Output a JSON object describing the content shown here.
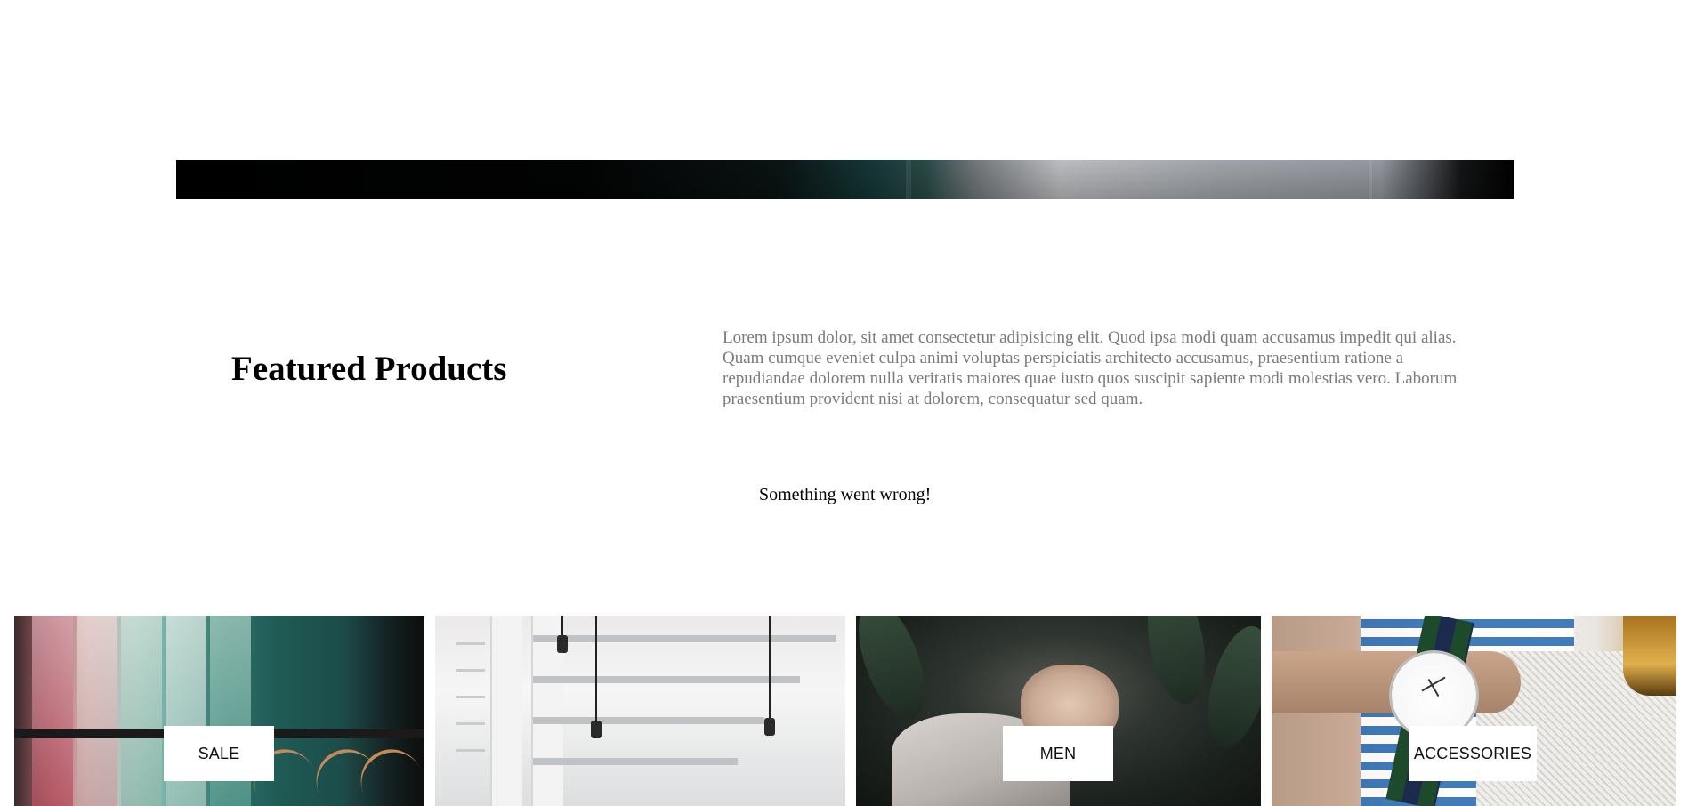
{
  "featured": {
    "title": "Featured Products",
    "description": "Lorem ipsum dolor, sit amet consectetur adipisicing elit. Quod ipsa modi quam accusamus impedit qui alias. Quam cumque eveniet culpa animi voluptas perspiciatis architecto accusamus, praesentium ratione a repudiandae dolorem nulla veritatis maiores quae iusto quos suscipit sapiente modi molestias vero. Laborum praesentium provident nisi at dolorem, consequatur sed quam."
  },
  "status": {
    "error_message": "Something went wrong!"
  },
  "categories": [
    {
      "label": "SALE"
    },
    {
      "label": ""
    },
    {
      "label": "MEN"
    },
    {
      "label": "ACCESSORIES"
    }
  ],
  "colors": {
    "background": "#ffffff",
    "text_primary": "#000000",
    "text_muted": "#7a7a7a",
    "label_background": "#ffffff"
  }
}
